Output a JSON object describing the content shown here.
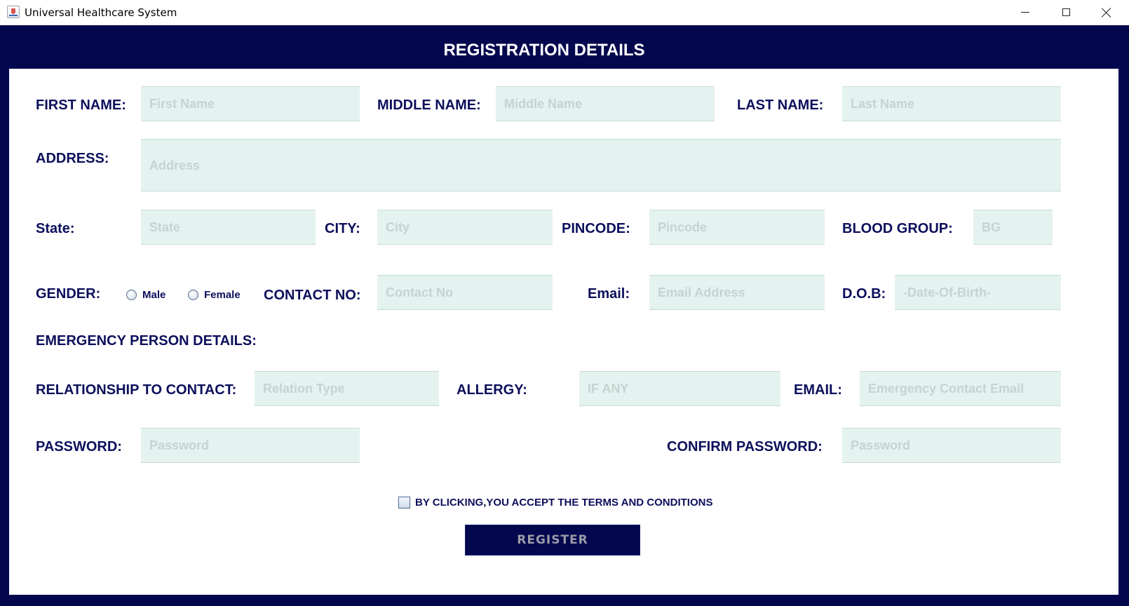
{
  "window": {
    "title": "Universal Healthcare System"
  },
  "header": {
    "title": "REGISTRATION DETAILS"
  },
  "form": {
    "first_name": {
      "label": "FIRST NAME:",
      "placeholder": "First Name"
    },
    "middle_name": {
      "label": "MIDDLE NAME:",
      "placeholder": "Middle Name"
    },
    "last_name": {
      "label": "LAST NAME:",
      "placeholder": "Last Name"
    },
    "address": {
      "label": "ADDRESS:",
      "placeholder": "Address"
    },
    "state": {
      "label": "State:",
      "placeholder": "State"
    },
    "city": {
      "label": "CITY:",
      "placeholder": "City"
    },
    "pincode": {
      "label": "PINCODE:",
      "placeholder": "Pincode"
    },
    "blood_group": {
      "label": "BLOOD GROUP:",
      "placeholder": "BG"
    },
    "gender": {
      "label": "GENDER:",
      "options": [
        "Male",
        "Female"
      ]
    },
    "contact_no": {
      "label": "CONTACT NO:",
      "placeholder": "Contact No"
    },
    "email": {
      "label": "Email:",
      "placeholder": "Email Address"
    },
    "dob": {
      "label": "D.O.B:",
      "placeholder": "-Date-Of-Birth-"
    },
    "emergency_heading": "EMERGENCY PERSON DETAILS:",
    "relationship": {
      "label": "RELATIONSHIP TO CONTACT:",
      "placeholder": "Relation Type"
    },
    "allergy": {
      "label": "ALLERGY:",
      "placeholder": "IF ANY"
    },
    "emergency_email": {
      "label": "EMAIL:",
      "placeholder": "Emergency Contact Email"
    },
    "password": {
      "label": "PASSWORD:",
      "placeholder": "Password"
    },
    "confirm_password": {
      "label": "CONFIRM PASSWORD:",
      "placeholder": "Password"
    },
    "terms_label": "BY CLICKING,YOU ACCEPT THE TERMS AND CONDITIONS",
    "register_label": "REGISTER"
  },
  "colors": {
    "frame": "#03074e",
    "label_text": "#0c0f5b",
    "field_bg": "#e5f3f0",
    "placeholder": "#c5d4d1"
  }
}
